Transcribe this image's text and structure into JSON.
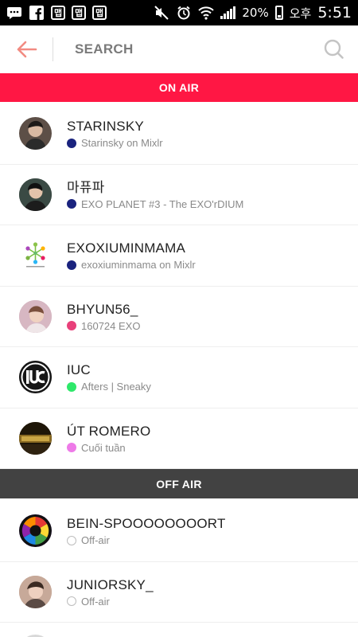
{
  "status_bar": {
    "battery_percent": "20%",
    "ampm": "오후",
    "time": "5:51",
    "app_notification_label": "맵"
  },
  "header": {
    "search_placeholder": "SEARCH"
  },
  "sections": {
    "on_air_label": "ON AIR",
    "off_air_label": "OFF AIR"
  },
  "on_air": [
    {
      "title": "STARINSKY",
      "subtitle": "Starinsky on Mixlr",
      "dot_color": "#1a237e",
      "avatar_color": "#5d4f47"
    },
    {
      "title": "마퓨파",
      "subtitle": "EXO PLANET #3 - The EXO'rDIUM",
      "dot_color": "#1a237e",
      "avatar_color": "#2f3b36"
    },
    {
      "title": "EXOXIUMINMAMA",
      "subtitle": "exoxiuminmama on Mixlr",
      "dot_color": "#1a237e",
      "avatar_color": "#ffffff"
    },
    {
      "title": "BHYUN56_",
      "subtitle": "160724 EXO",
      "dot_color": "#e8407a",
      "avatar_color": "#c9a9b3"
    },
    {
      "title": "IUC",
      "subtitle": "Afters | Sneaky",
      "dot_color": "#2ee86a",
      "avatar_color": "#161616"
    },
    {
      "title": "ÚT ROMERO",
      "subtitle": "Cuối tuần",
      "dot_color": "#ee7ae8",
      "avatar_color": "#3a2a10"
    }
  ],
  "off_air": [
    {
      "title": "BEIN-SPOOOOOOOORT",
      "subtitle": "Off-air",
      "avatar_color": "#5b2c8c"
    },
    {
      "title": "JUNIORSKY_",
      "subtitle": "Off-air",
      "avatar_color": "#b08d7a"
    }
  ],
  "colors": {
    "on_air_bar": "#ff1744",
    "off_air_bar": "#424242",
    "back_arrow": "#f28b82"
  }
}
